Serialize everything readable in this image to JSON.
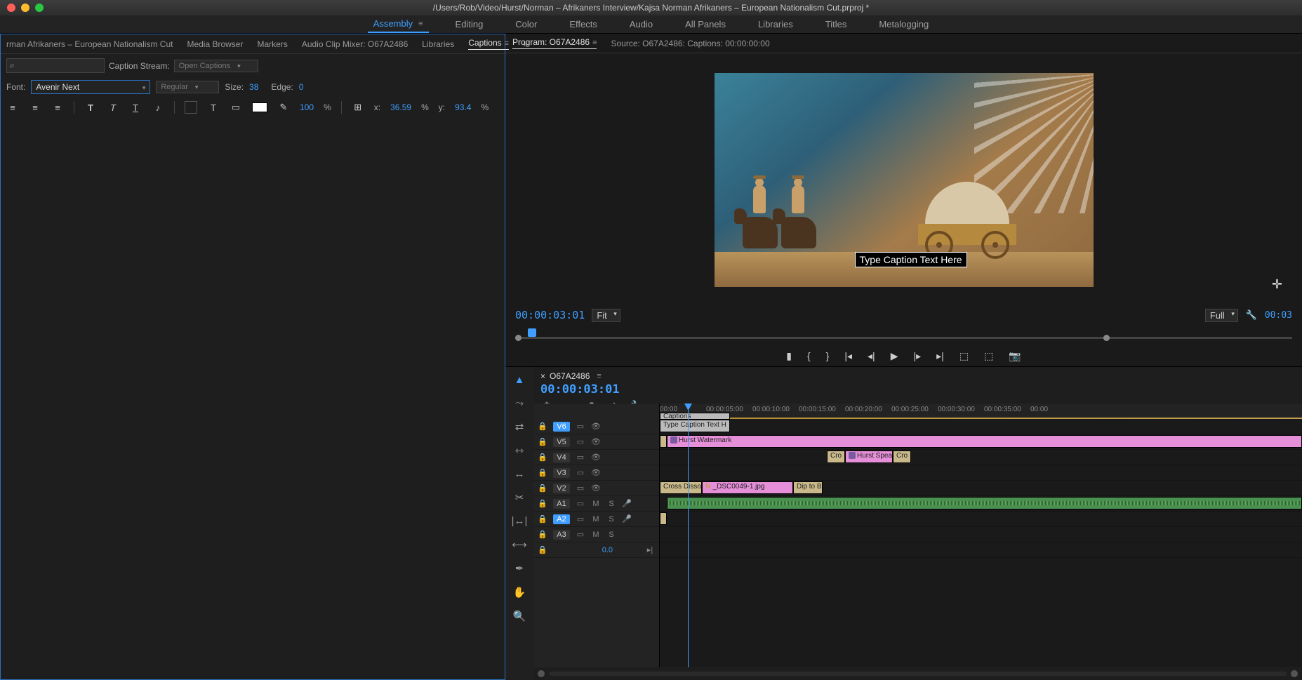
{
  "titlebar": {
    "path": "/Users/Rob/Video/Hurst/Norman – Afrikaners Interview/Kajsa Norman Afrikaners – European Nationalism Cut.prproj *"
  },
  "workspaces": [
    "Assembly",
    "Editing",
    "Color",
    "Effects",
    "Audio",
    "All Panels",
    "Libraries",
    "Titles",
    "Metalogging"
  ],
  "active_workspace": "Assembly",
  "left_panel": {
    "tabs": [
      "rman Afrikaners – European Nationalism Cut",
      "Media Browser",
      "Markers",
      "Audio Clip Mixer: O67A2486",
      "Libraries",
      "Captions"
    ],
    "active_tab": "Captions",
    "caption_stream_label": "Caption Stream:",
    "caption_stream_value": "Open Captions",
    "font_label": "Font:",
    "font_value": "Avenir Next",
    "font_style": "Regular",
    "size_label": "Size:",
    "size_value": "38",
    "edge_label": "Edge:",
    "edge_value": "0",
    "opacity_value": "100",
    "opacity_pct": "%",
    "x_label": "x:",
    "x_value": "36.59",
    "x_pct": "%",
    "y_label": "y:",
    "y_value": "93.4",
    "y_pct": "%"
  },
  "program": {
    "tab_label": "Program: O67A2486",
    "source_label": "Source: O67A2486: Captions: 00:00:00:00",
    "caption_overlay": "Type Caption Text Here",
    "timecode": "00:00:03:01",
    "zoom": "Fit",
    "quality": "Full",
    "duration": "00:03"
  },
  "timeline": {
    "seq_name": "O67A2486",
    "timecode": "00:00:03:01",
    "ruler_ticks": [
      "00:00",
      "00:00:05:00",
      "00:00:10:00",
      "00:00:15:00",
      "00:00:20:00",
      "00:00:25:00",
      "00:00:30:00",
      "00:00:35:00",
      "00:00"
    ],
    "tracks_v": [
      "V6",
      "V5",
      "V4",
      "V3",
      "V2"
    ],
    "tracks_a": [
      "A1",
      "A2",
      "A3"
    ],
    "selected_v": "V6",
    "selected_a": "A2",
    "master_gain": "0.0",
    "clips": {
      "v6a": "Captions",
      "v6b": "Type Caption Text H",
      "v5": "Hurst Watermark",
      "v4_trans1": "Cro",
      "v4_clip": "Hurst Spea",
      "v4_trans2": "Cro",
      "v2_trans1": "Cross Dissol",
      "v2_clip": "_DSC0049-1.jpg",
      "v2_trans2": "Dip to B"
    }
  }
}
